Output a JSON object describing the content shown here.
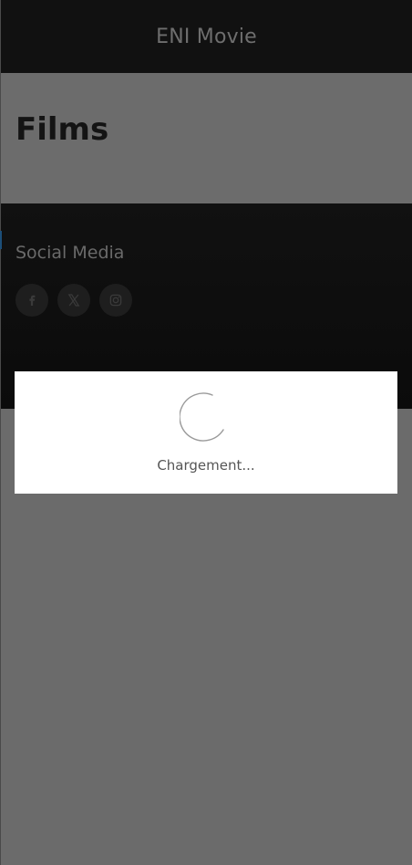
{
  "header": {
    "title": "ENI Movie"
  },
  "main": {
    "page_title": "Films"
  },
  "footer": {
    "social_title": "Social Media",
    "social_links": [
      {
        "name": "facebook",
        "icon": "facebook-icon"
      },
      {
        "name": "x",
        "icon": "x-icon"
      },
      {
        "name": "instagram",
        "icon": "instagram-icon"
      }
    ]
  },
  "loading": {
    "text": "Chargement..."
  },
  "colors": {
    "overlay": "#6b6b6b",
    "header_bg": "#111111",
    "footer_bg": "#111111",
    "modal_bg": "#ffffff"
  }
}
